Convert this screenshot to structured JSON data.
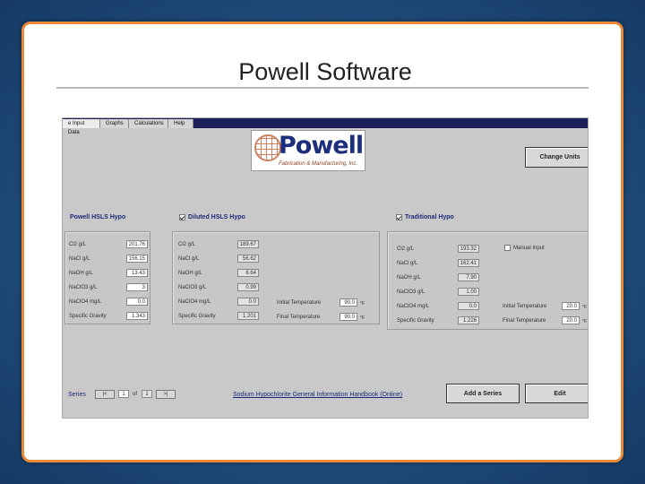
{
  "slide": {
    "title": "Powell Software"
  },
  "tabs": [
    {
      "label": "e Input Data"
    },
    {
      "label": "Graphs"
    },
    {
      "label": "Calculations"
    },
    {
      "label": "Help"
    }
  ],
  "logo": {
    "word": "Powell",
    "sub": "Fabrication & Manufacturing, Inc."
  },
  "buttons": {
    "change_units": "Change Units",
    "add_series": "Add a Series",
    "edit": "Edit"
  },
  "hsls": {
    "title": "Powell HSLS Hypo",
    "fields": [
      {
        "label": "Cl2 g/L",
        "value": "201.76"
      },
      {
        "label": "NaCl g/L",
        "value": "156.15"
      },
      {
        "label": "NaOH g/L",
        "value": "13.43"
      },
      {
        "label": "NaClO3 g/L",
        "value": "3"
      },
      {
        "label": "NaClO4 mg/L",
        "value": "0.0"
      },
      {
        "label": "Specific Gravity",
        "value": "1.343"
      }
    ]
  },
  "diluted": {
    "title": "Diluted HSLS Hypo",
    "checked": true,
    "fields": [
      {
        "label": "Cl2 g/L",
        "value": "189.67"
      },
      {
        "label": "NaCl g/L",
        "value": "56.62"
      },
      {
        "label": "NaOH g/L",
        "value": "6.64"
      },
      {
        "label": "NaClO3 g/L",
        "value": "0.99"
      },
      {
        "label": "NaClO4 mg/L",
        "value": "0.0"
      },
      {
        "label": "Specific Gravity",
        "value": "1.201"
      }
    ],
    "initial_temp_label": "Initial Temperature",
    "initial_temp_value": "90.0",
    "final_temp_label": "Final Temperature",
    "final_temp_value": "90.0",
    "temp_unit": "°F"
  },
  "traditional": {
    "title": "Traditional Hypo",
    "checked": true,
    "manual_input_label": "Manual Input",
    "fields": [
      {
        "label": "Cl2 g/L",
        "value": "193.32"
      },
      {
        "label": "NaCl g/L",
        "value": "162.41"
      },
      {
        "label": "NaOH g/L",
        "value": "7.90"
      },
      {
        "label": "NaClO3 g/L",
        "value": "1.00"
      },
      {
        "label": "NaClO4 mg/L",
        "value": "0.0"
      },
      {
        "label": "Specific Gravity",
        "value": "1.226"
      }
    ],
    "initial_temp_label": "Initial Temperature",
    "initial_temp_value": "20.0",
    "final_temp_label": "Final Temperature",
    "final_temp_value": "20.0",
    "temp_unit": "°F"
  },
  "footer": {
    "series_label": "Series",
    "first_btn": "|<",
    "current": "1",
    "of_label": "of",
    "total": "1",
    "last_btn": ">|",
    "link": "Sodium Hypochlorite General Information Handbook (Online)"
  }
}
